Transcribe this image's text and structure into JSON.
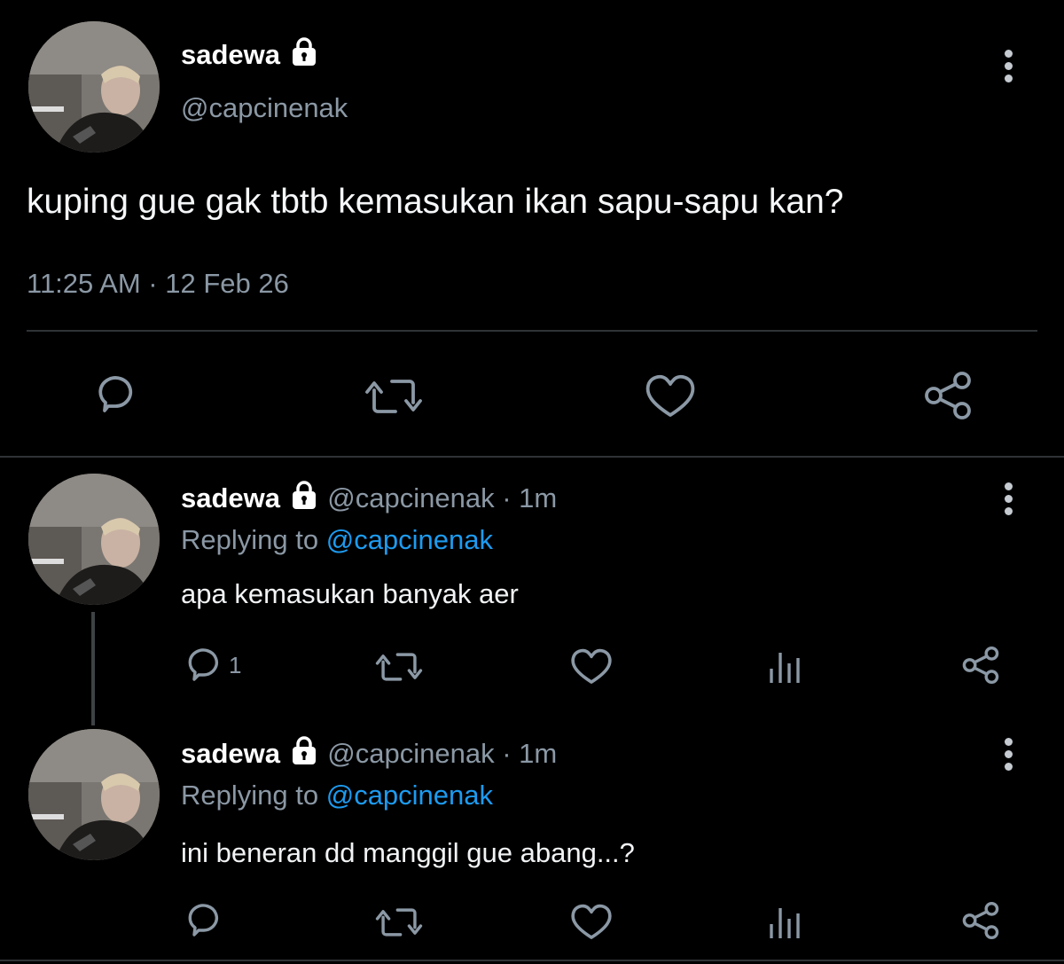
{
  "main_tweet": {
    "display_name": "sadewa",
    "handle": "@capcinenak",
    "text": "kuping gue gak tbtb kemasukan ikan sapu-sapu kan?",
    "timestamp": "11:25 AM · 12 Feb 26",
    "actions": [
      "reply-icon",
      "retweet-icon",
      "like-icon",
      "share-icon"
    ]
  },
  "replies": [
    {
      "display_name": "sadewa",
      "handle": "@capcinenak",
      "time": "· 1m",
      "replying_prefix": "Replying to",
      "replying_to": "@capcinenak",
      "text": "apa kemasukan banyak aer",
      "reply_count": "1"
    },
    {
      "display_name": "sadewa",
      "handle": "@capcinenak",
      "time": "· 1m",
      "replying_prefix": "Replying to",
      "replying_to": "@capcinenak",
      "text": "ini beneran dd manggil gue abang...?",
      "reply_count": ""
    }
  ],
  "colors": {
    "background": "#000000",
    "primary_text": "#ffffff",
    "secondary_text": "#8b98a5",
    "mention": "#1d9bf0",
    "divider": "#2f3336",
    "icon": "#8b98a5"
  }
}
